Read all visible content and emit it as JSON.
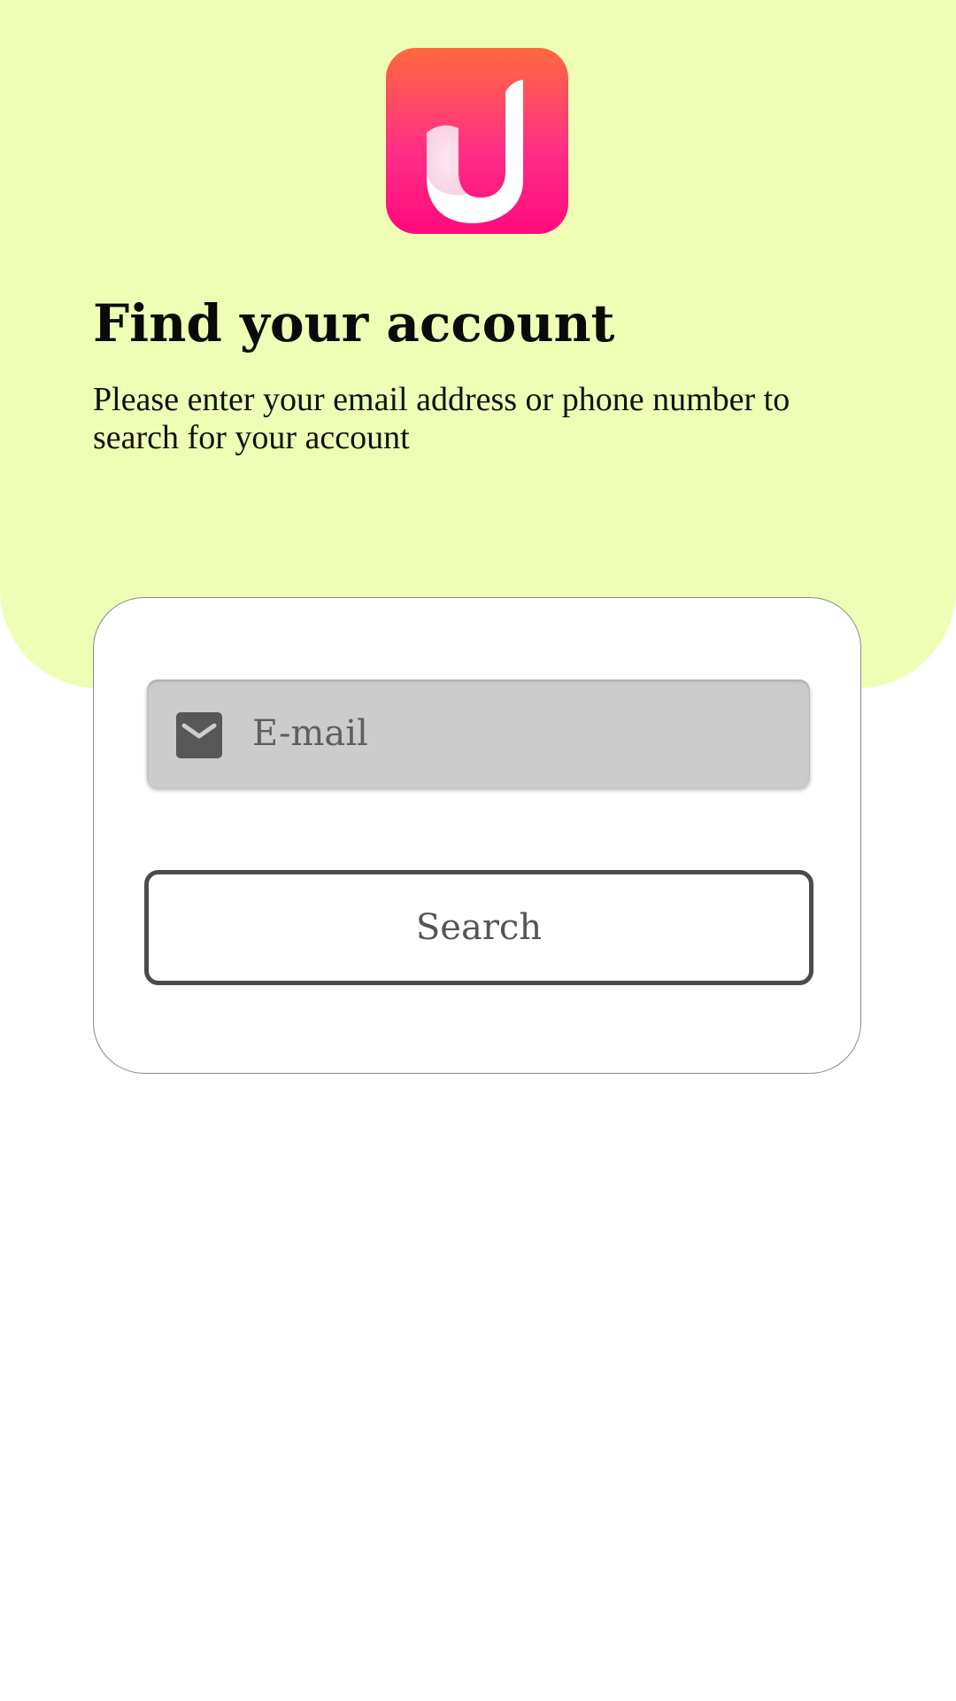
{
  "colors": {
    "header_background": "#eeffb5",
    "logo_gradient_top": "#ff6a3d",
    "logo_gradient_bottom": "#ff0a7d",
    "field_background": "#cccccc",
    "button_border": "#4b4b4b"
  },
  "logo": {
    "icon": "app-logo-icon"
  },
  "header": {
    "title": "Find your account",
    "subtitle": "Please enter your email address or phone number to search for your account"
  },
  "form": {
    "email": {
      "icon": "mail-icon",
      "placeholder": "E-mail",
      "value": ""
    },
    "search_label": "Search"
  }
}
